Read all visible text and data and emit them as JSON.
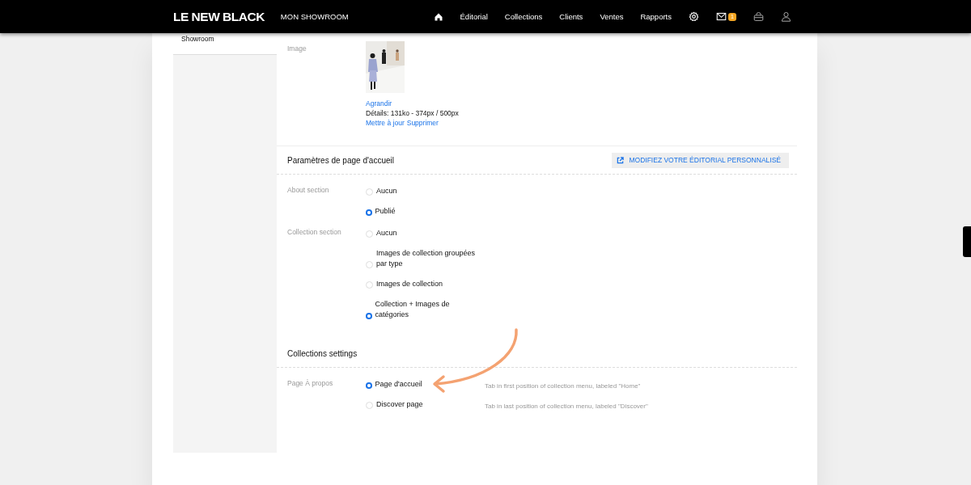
{
  "header": {
    "logo": "LE NEW BLACK",
    "showroom": "MON SHOWROOM",
    "nav": [
      {
        "label": "Éditorial"
      },
      {
        "label": "Collections"
      },
      {
        "label": "Clients"
      },
      {
        "label": "Ventes"
      },
      {
        "label": "Rapports"
      }
    ],
    "badge": "1"
  },
  "sidebar": {
    "items": [
      {
        "label": "Showroom"
      }
    ]
  },
  "image_field": {
    "label": "Image",
    "enlarge": "Agrandir",
    "details": "Détails: 131ko - 374px / 500px",
    "links": [
      "Mettre à jour",
      "Supprimer"
    ]
  },
  "sections": [
    {
      "title": "Paramètres de page d'accueil",
      "button": "MODIFIEZ VOTRE ÉDITORIAL PERSONNALISÉ",
      "fields": [
        {
          "label": "About section",
          "options": [
            {
              "label": "Aucun",
              "selected": false
            },
            {
              "label": "Publié",
              "selected": true
            }
          ]
        },
        {
          "label": "Collection section",
          "options": [
            {
              "label": "Aucun",
              "selected": false
            },
            {
              "label": "Images de collection groupées par type",
              "selected": false
            },
            {
              "label": "Images de collection",
              "selected": false
            },
            {
              "label": "Collection + Images de catégories",
              "selected": true
            }
          ]
        }
      ]
    },
    {
      "title": "Collections settings",
      "fields": [
        {
          "label": "Page À propos",
          "options": [
            {
              "label": "Page d'accueil",
              "selected": true,
              "hint": "Tab in first position of collection menu, labeled \"Home\""
            },
            {
              "label": "Discover page",
              "selected": false,
              "hint": "Tab in last position of collection menu, labeled \"Discover\""
            }
          ]
        }
      ]
    }
  ]
}
